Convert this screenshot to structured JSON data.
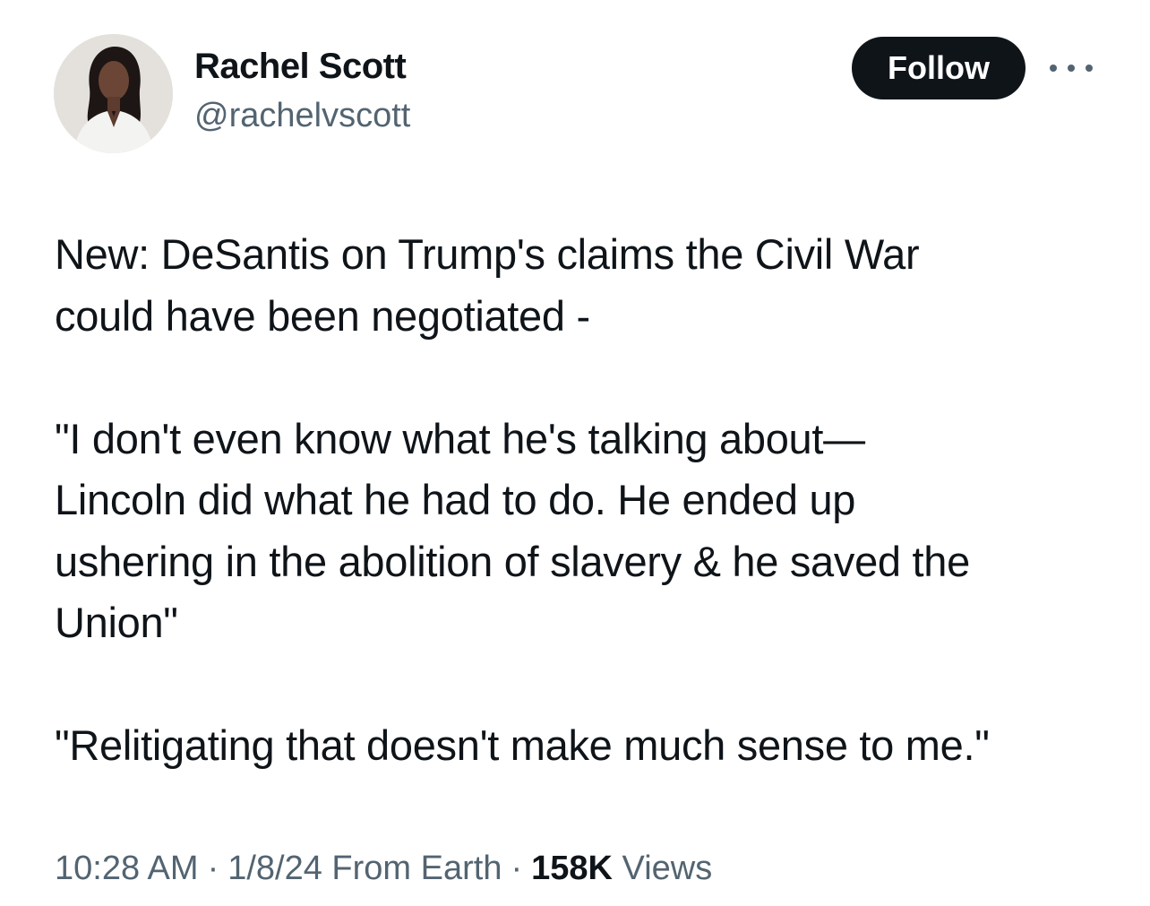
{
  "author": {
    "display_name": "Rachel Scott",
    "handle": "@rachelvscott"
  },
  "actions": {
    "follow_label": "Follow",
    "more_icon": "more-horizontal-icon"
  },
  "tweet": {
    "paragraphs": [
      [
        "New: DeSantis on Trump's claims the Civil War",
        "could have been negotiated -"
      ],
      [
        "\"I don't even know what he's talking about—",
        "Lincoln did what he had to do. He ended up",
        "ushering in the abolition of slavery & he saved the",
        "Union\""
      ],
      [
        "\"Relitigating that doesn't make much sense to me.\""
      ]
    ]
  },
  "meta": {
    "time": "10:28 AM",
    "separator": "·",
    "date_source": "1/8/24 From Earth",
    "views_count": "158K",
    "views_label": "Views"
  },
  "colors": {
    "text_primary": "#0f1419",
    "text_secondary": "#536471",
    "button_bg": "#0f1419",
    "button_text": "#ffffff"
  }
}
